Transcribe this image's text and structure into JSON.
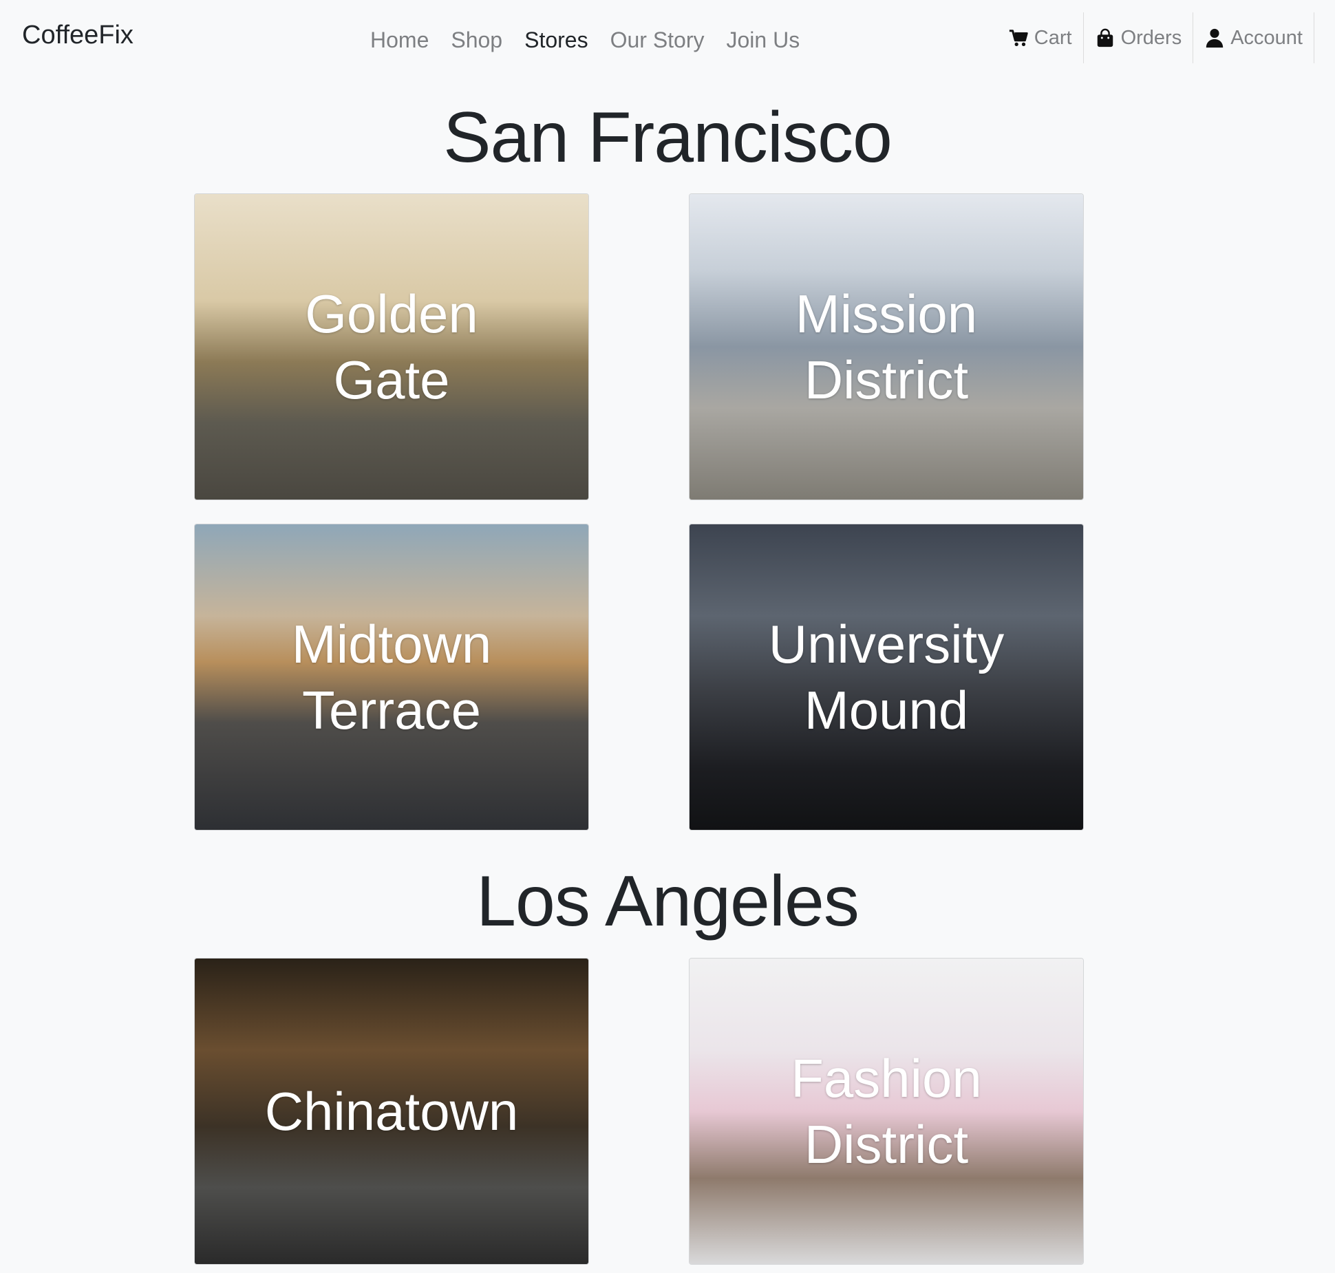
{
  "nav": {
    "brand": "CoffeeFix",
    "links": [
      {
        "label": "Home",
        "active": false
      },
      {
        "label": "Shop",
        "active": false
      },
      {
        "label": "Stores",
        "active": true
      },
      {
        "label": "Our Story",
        "active": false
      },
      {
        "label": "Join Us",
        "active": false
      }
    ],
    "right": [
      {
        "label": "Cart",
        "icon": "cart-icon"
      },
      {
        "label": "Orders",
        "icon": "shopping-bag-icon"
      },
      {
        "label": "Account",
        "icon": "user-icon"
      }
    ]
  },
  "cities": [
    {
      "name": "San Francisco",
      "stores": [
        {
          "label": "Golden Gate",
          "image": "golden-gate-bridge-photo"
        },
        {
          "label": "Mission District",
          "image": "city-skyline-photo"
        },
        {
          "label": "Midtown Terrace",
          "image": "sunset-skyline-photo"
        },
        {
          "label": "University Mound",
          "image": "street-pedestrian-photo"
        }
      ]
    },
    {
      "name": "Los Angeles",
      "stores": [
        {
          "label": "Chinatown",
          "image": "chinatown-street-night-photo"
        },
        {
          "label": "Fashion District",
          "image": "pink-building-utility-pole-photo"
        }
      ]
    }
  ],
  "colors": {
    "background": "#f8f9fa",
    "text": "#212529",
    "nav_muted": "#7d7f82",
    "card_text": "#ffffff"
  }
}
